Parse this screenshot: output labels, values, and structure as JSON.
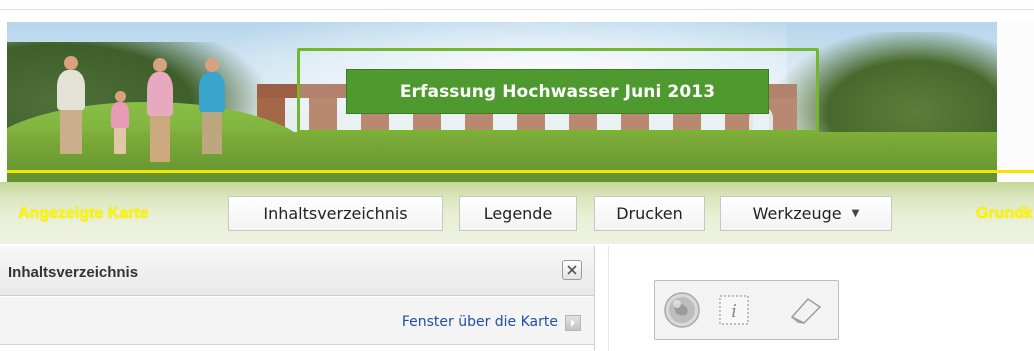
{
  "banner": {
    "title": "Erfassung Hochwasser Juni 2013",
    "colors": {
      "title_bg": "#4f9a2f",
      "frame": "#74b72e",
      "accent_line": "#f3e500"
    }
  },
  "toolbar": {
    "left_label": "Angezeigte Karte",
    "buttons": [
      {
        "label": "Inhaltsverzeichnis"
      },
      {
        "label": "Legende"
      },
      {
        "label": "Drucken"
      },
      {
        "label": "Werkzeuge",
        "icon": "caret-down-icon"
      }
    ],
    "right_label": "Grundk"
  },
  "panel": {
    "title": "Inhaltsverzeichnis",
    "close_icon": "close-icon",
    "float_link": "Fenster über die Karte",
    "float_icon": "arrow-right-icon"
  },
  "map_tools": [
    {
      "icon": "globe-icon"
    },
    {
      "icon": "info-icon",
      "glyph": "i"
    },
    {
      "icon": "eraser-icon"
    }
  ]
}
